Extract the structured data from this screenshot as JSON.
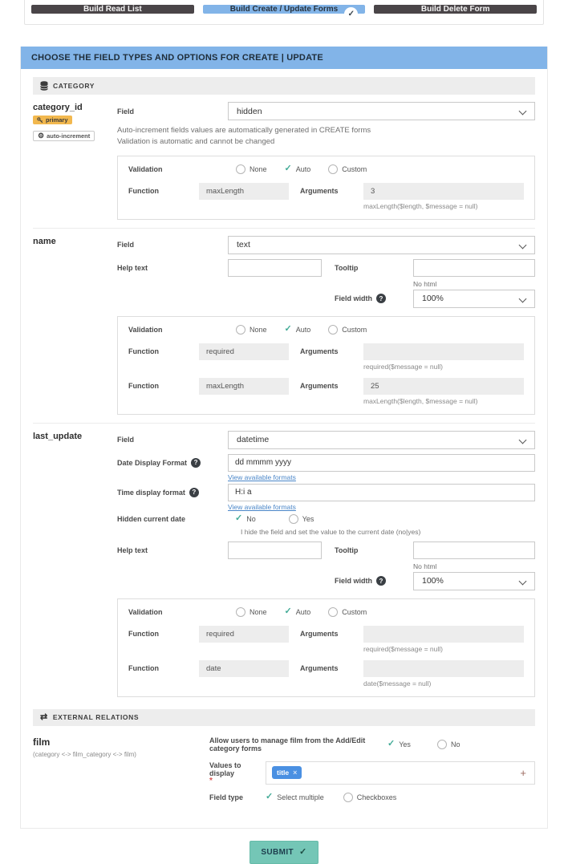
{
  "icons": {
    "check": "✓",
    "plus": "+",
    "close": "×",
    "question": "?",
    "swap": "⇄",
    "gear": "⚙"
  },
  "steps": [
    {
      "label": "Build Read List"
    },
    {
      "label": "Build Create / Update Forms"
    },
    {
      "label": "Build Delete Form"
    }
  ],
  "banner": {
    "title": "CHOOSE THE FIELD TYPES AND OPTIONS FOR CREATE | UPDATE"
  },
  "common": {
    "field": "Field",
    "help_text": "Help text",
    "tooltip": "Tooltip",
    "no_html": "No html",
    "field_width": "Field width",
    "field_width_value": "100%",
    "validation": "Validation",
    "function": "Function",
    "arguments": "Arguments",
    "none": "None",
    "auto": "Auto",
    "custom": "Custom",
    "view_formats": "View available formats"
  },
  "category_section": {
    "title": "CATEGORY"
  },
  "category_id": {
    "name": "category_id",
    "badge_primary": "primary",
    "badge_auto_increment": "auto-increment",
    "field_value": "hidden",
    "note_line1": "Auto-increment fields values are automatically generated in CREATE forms",
    "note_line2": "Validation is automatic and cannot be changed",
    "validators": [
      {
        "fn": "maxLength",
        "args": "3",
        "hint": "maxLength($length, $message = null)"
      }
    ]
  },
  "name_field": {
    "name": "name",
    "field_value": "text",
    "validators": [
      {
        "fn": "required",
        "args": "",
        "hint": "required($message = null)"
      },
      {
        "fn": "maxLength",
        "args": "25",
        "hint": "maxLength($length, $message = null)"
      }
    ]
  },
  "last_update": {
    "name": "last_update",
    "field_value": "datetime",
    "date_format_label": "Date Display Format",
    "date_format_value": "dd mmmm yyyy",
    "time_format_label": "Time display format",
    "time_format_value": "H:i a",
    "hidden_current_date_label": "Hidden current date",
    "no": "No",
    "yes": "Yes",
    "hidden_note": "I hide the field and set the value to the current date (no|yes)",
    "validators": [
      {
        "fn": "required",
        "args": "",
        "hint": "required($message = null)"
      },
      {
        "fn": "date",
        "args": "",
        "hint": "date($message = null)"
      }
    ]
  },
  "external_section": {
    "title": "EXTERNAL RELATIONS"
  },
  "film": {
    "name": "film",
    "relation": "(category <-> film_category <-> film)",
    "manage_label": "Allow users to manage film from the Add/Edit category forms",
    "yes": "Yes",
    "no": "No",
    "values_to_display": "Values to display",
    "required_mark": "*",
    "chip": "title",
    "field_type": "Field type",
    "select_multiple": "Select multiple",
    "checkboxes": "Checkboxes"
  },
  "submit": {
    "label": "SUBMIT"
  }
}
